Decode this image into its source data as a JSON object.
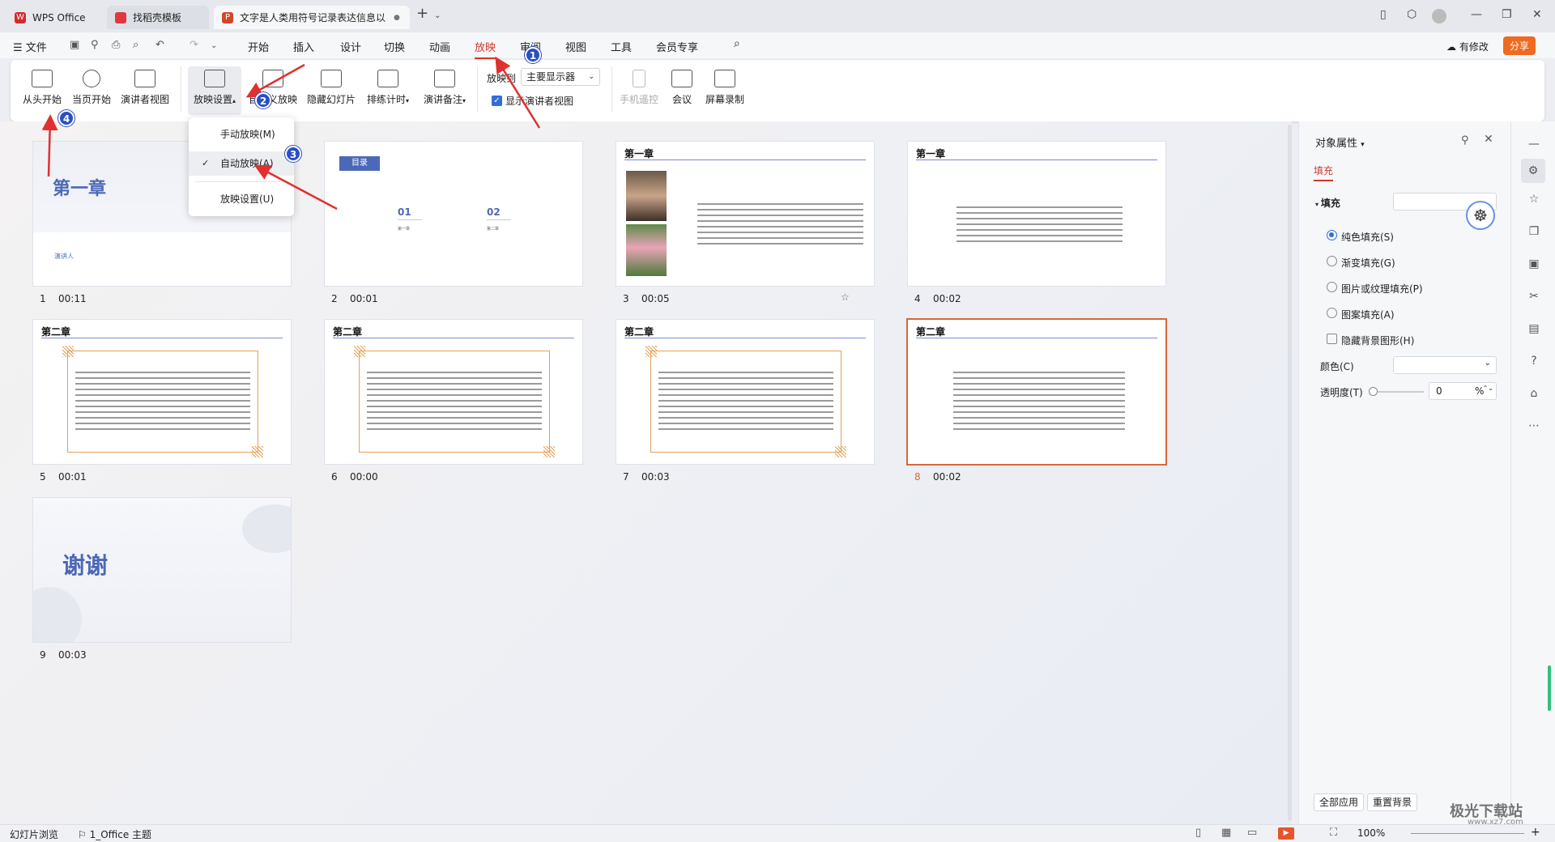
{
  "tabs": [
    {
      "label": "WPS Office",
      "color": "#d8282c"
    },
    {
      "label": "找稻壳模板",
      "color": "#e0383b"
    },
    {
      "label": "文字是人类用符号记录表达信息以",
      "color": "#d24726"
    }
  ],
  "menu": {
    "file": "文件",
    "items": [
      "开始",
      "插入",
      "设计",
      "切换",
      "动画",
      "放映",
      "审阅",
      "视图",
      "工具",
      "会员专享"
    ],
    "active": "放映",
    "has_changes": "有修改",
    "share": "分享"
  },
  "ribbon": {
    "from_start": "从头开始",
    "from_current": "当页开始",
    "presenter_view": "演讲者视图",
    "settings": "放映设置",
    "custom_show": "自定义放映",
    "hide_slide": "隐藏幻灯片",
    "rehearse": "排练计时",
    "speaker_notes": "演讲备注",
    "show_on_label": "放映到",
    "show_on_value": "主要显示器",
    "show_presenter_check": "显示演讲者视图",
    "phone_remote": "手机遥控",
    "meeting": "会议",
    "screen_record": "屏幕录制"
  },
  "dropdown": [
    "手动放映(M)",
    "自动放映(A)",
    "放映设置(U)"
  ],
  "slides": [
    {
      "num": "1",
      "time": "00:11",
      "title": "第一章",
      "presenter": "演讲人"
    },
    {
      "num": "2",
      "time": "00:01",
      "tag": "目录",
      "items": [
        "01",
        "02"
      ],
      "subs": [
        "第一章",
        "第二章"
      ]
    },
    {
      "num": "3",
      "time": "00:05",
      "title": "第一章"
    },
    {
      "num": "4",
      "time": "00:02",
      "title": "第一章"
    },
    {
      "num": "5",
      "time": "00:01",
      "title": "第二章"
    },
    {
      "num": "6",
      "time": "00:00",
      "title": "第二章"
    },
    {
      "num": "7",
      "time": "00:03",
      "title": "第二章"
    },
    {
      "num": "8",
      "time": "00:02",
      "title": "第二章"
    },
    {
      "num": "9",
      "time": "00:03",
      "title": "谢谢"
    }
  ],
  "panel": {
    "title": "对象属性",
    "tab": "填充",
    "section": "填充",
    "options": [
      "纯色填充(S)",
      "渐变填充(G)",
      "图片或纹理填充(P)",
      "图案填充(A)"
    ],
    "hide_bg": "隐藏背景图形(H)",
    "color_label": "颜色(C)",
    "transparency_label": "透明度(T)",
    "transparency_value": "0",
    "percent": "%",
    "apply_all": "全部应用",
    "reset_bg": "重置背景"
  },
  "status": {
    "view": "幻灯片浏览",
    "theme": "1_Office 主题",
    "zoom": "100%"
  },
  "badges": [
    "1",
    "2",
    "3",
    "4"
  ],
  "watermark": "极光下载站",
  "watermark_url": "www.xz7.com"
}
